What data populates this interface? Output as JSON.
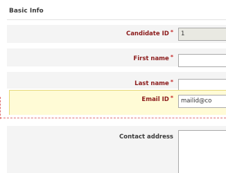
{
  "section": {
    "title": "Basic Info"
  },
  "fields": {
    "candidate_id": {
      "label": "Candidate ID",
      "required_mark": "*",
      "value": "1"
    },
    "first_name": {
      "label": "First name",
      "required_mark": "*",
      "value": ""
    },
    "last_name": {
      "label": "Last name",
      "required_mark": "*",
      "value": ""
    },
    "email_id": {
      "label": "Email ID",
      "required_mark": "*",
      "value": "mailid@co"
    },
    "contact_address": {
      "label": "Contact address",
      "value": ""
    }
  },
  "colors": {
    "required_label": "#8b1a1a",
    "required_star": "#c62828",
    "highlight_bg": "#fffbd6",
    "validation_dashed": "#e07070"
  }
}
